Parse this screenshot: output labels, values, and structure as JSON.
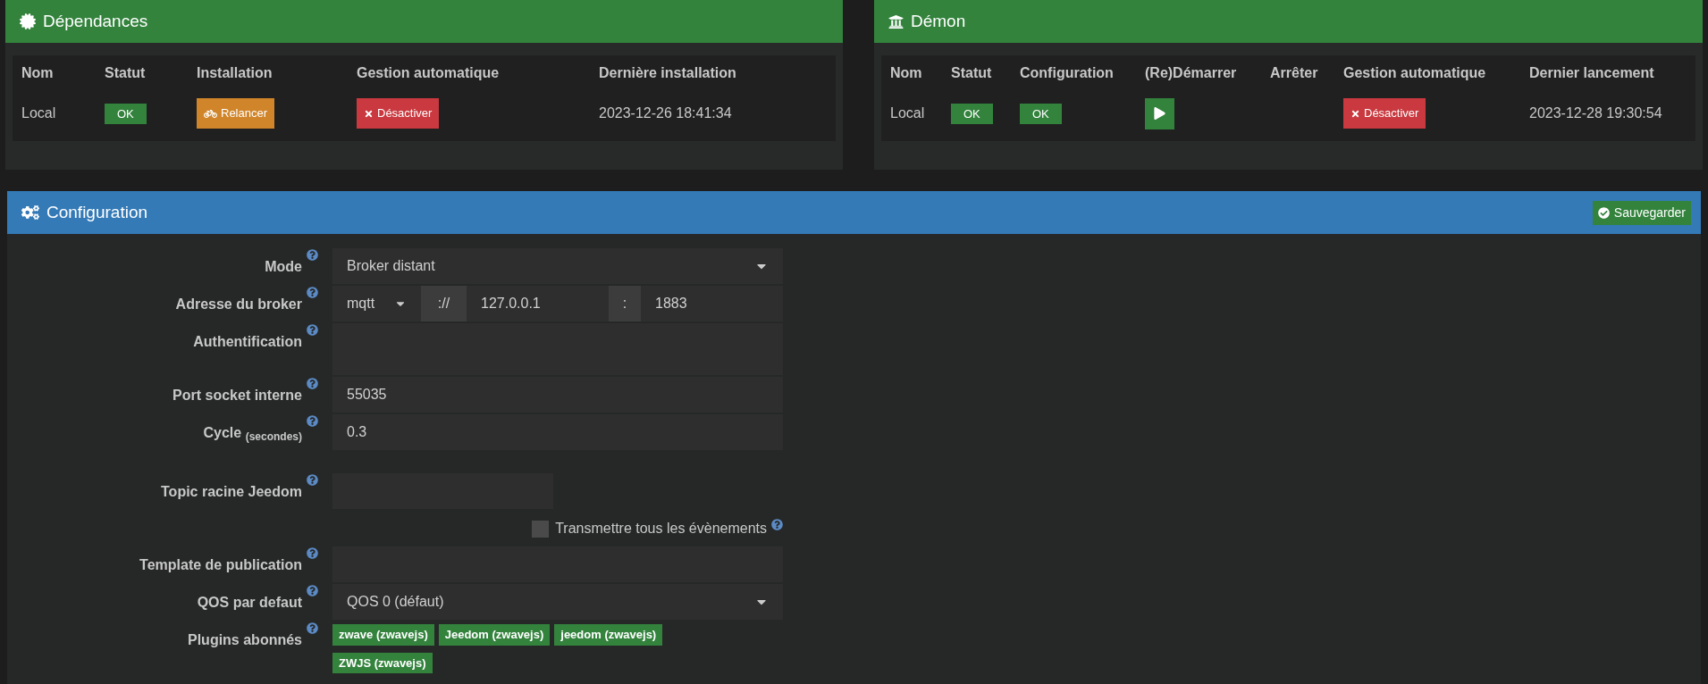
{
  "dependencies": {
    "title": "Dépendances",
    "columns": [
      "Nom",
      "Statut",
      "Installation",
      "Gestion automatique",
      "Dernière installation"
    ],
    "row": {
      "name": "Local",
      "status": "OK",
      "install_button": "Relancer",
      "auto_button": "Désactiver",
      "date": "2023-12-26 18:41:34"
    }
  },
  "daemon": {
    "title": "Démon",
    "columns": [
      "Nom",
      "Statut",
      "Configuration",
      "(Re)Démarrer",
      "Arrêter",
      "Gestion automatique",
      "Dernier lancement"
    ],
    "row": {
      "name": "Local",
      "status": "OK",
      "configuration": "OK",
      "auto_button": "Désactiver",
      "date": "2023-12-28 19:30:54"
    }
  },
  "configuration": {
    "title": "Configuration",
    "save_button": "Sauvegarder",
    "fields": [
      {
        "kind": "select",
        "label": "Mode",
        "value": "Broker distant"
      },
      {
        "kind": "broker",
        "label": "Adresse du broker",
        "protocol": "mqtt",
        "separator": "://",
        "host": "127.0.0.1",
        "colon": ":",
        "port": "1883"
      },
      {
        "kind": "textarea",
        "label": "Authentification"
      },
      {
        "kind": "input",
        "label": "Port socket interne",
        "value": "55035"
      },
      {
        "kind": "input",
        "label": "Cycle $_{(secondes)}$",
        "value": "0.3"
      },
      {
        "kind": "short",
        "label": "Topic racine Jeedom",
        "checkbox": {
          "label": "Transmettre tous les évènements",
          "checked": false
        }
      },
      {
        "kind": "input",
        "label": "Template de publication"
      },
      {
        "kind": "select",
        "label": "QOS par defaut",
        "value": "QOS 0 (défaut)"
      },
      {
        "kind": "tags",
        "label": "Plugins abonnés",
        "tags": [
          "zwave (zwavejs)",
          "Jeedom (zwavejs)",
          "jeedom (zwavejs)",
          "ZWJS (zwavejs)"
        ]
      }
    ]
  }
}
